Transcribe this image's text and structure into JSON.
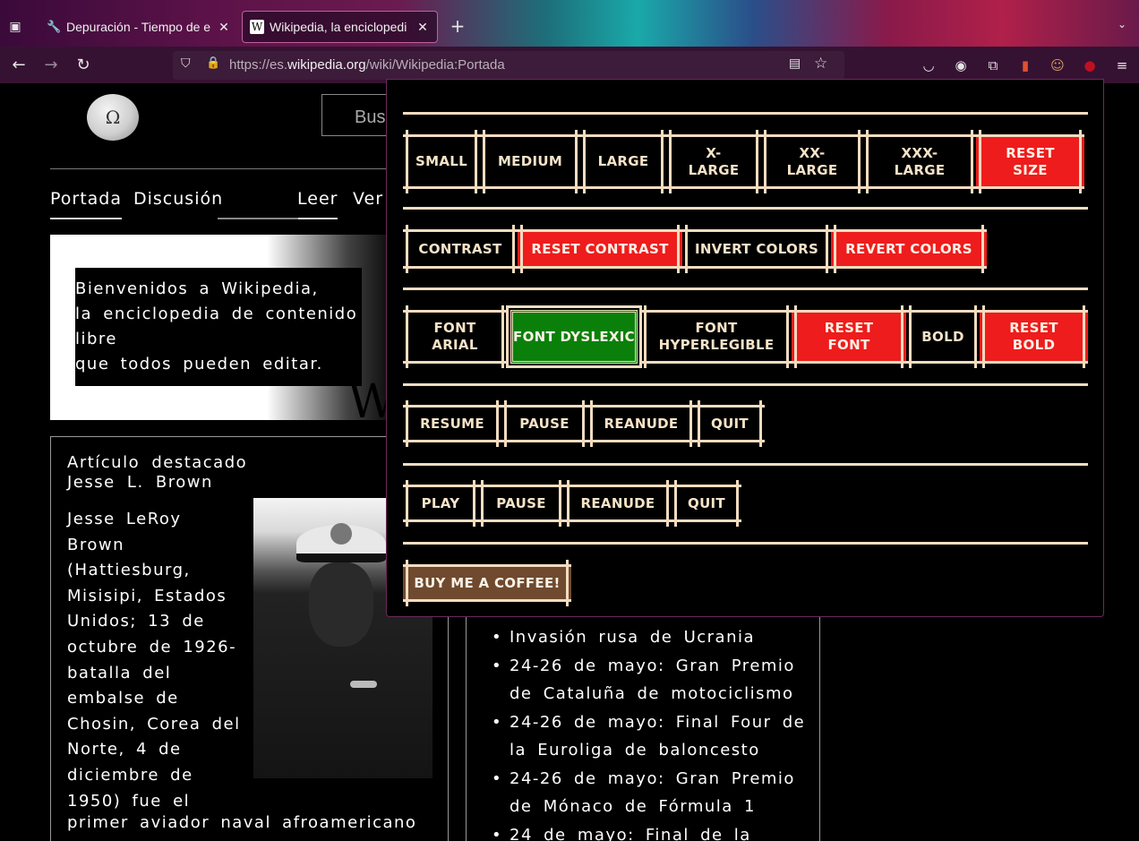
{
  "browser": {
    "tabs": [
      {
        "title": "Depuración - Tiempo de e",
        "icon": "wrench-icon",
        "active": false
      },
      {
        "title": "Wikipedia, la enciclopedi",
        "icon": "wikipedia-w-icon",
        "active": true
      }
    ],
    "url_prefix": "https://es.",
    "url_domain": "wikipedia.org",
    "url_path": "/wiki/Wikipedia:Portada"
  },
  "wiki": {
    "search_placeholder": "Bus",
    "tabs": {
      "portada": "Portada",
      "discusion": "Discusión",
      "leer": "Leer",
      "ver": "Ver"
    },
    "welcome": {
      "line1": "Bienvenidos a Wikipedia,",
      "line2": "la enciclopedia de contenido libre",
      "line3": "que todos pueden editar."
    },
    "featured": {
      "heading": "Artículo destacado",
      "subject": "Jesse L. Brown",
      "body": "Jesse LeRoy Brown (Hattiesburg, Misisipi, Estados Unidos; 13 de octubre de 1926-batalla del embalse de Chosin, Corea del Norte, 4 de diciembre de 1950) fue el",
      "body_cont": "primer aviador naval afroamericano"
    },
    "news": [
      "Invasión rusa de Ucrania",
      "24-26 de mayo: Gran Premio de Cataluña de motociclismo",
      "24-26 de mayo: Final Four de la Euroliga de baloncesto",
      "24-26 de mayo: Gran Premio de Mónaco de Fórmula 1",
      "24 de mayo: Final de la"
    ]
  },
  "popup": {
    "size_row": [
      "SMALL",
      "MEDIUM",
      "LARGE",
      "X-LARGE",
      "XX-LARGE",
      "XXX-LARGE",
      "RESET SIZE"
    ],
    "color_row": [
      "CONTRAST",
      "RESET CONTRAST",
      "INVERT COLORS",
      "REVERT COLORS"
    ],
    "font_row": [
      "FONT ARIAL",
      "FONT DYSLEXIC",
      "FONT HYPERLEGIBLE",
      "RESET FONT",
      "BOLD",
      "RESET BOLD"
    ],
    "read_row": [
      "RESUME",
      "PAUSE",
      "REANUDE",
      "QUIT"
    ],
    "play_row": [
      "PLAY",
      "PAUSE",
      "REANUDE",
      "QUIT"
    ],
    "coffee": "BUY ME A COFFEE!",
    "colors": {
      "accent": "#f2dcc0",
      "reset": "#ee1c1c",
      "active": "#0a800a",
      "coffee": "#6f4a2e"
    }
  }
}
